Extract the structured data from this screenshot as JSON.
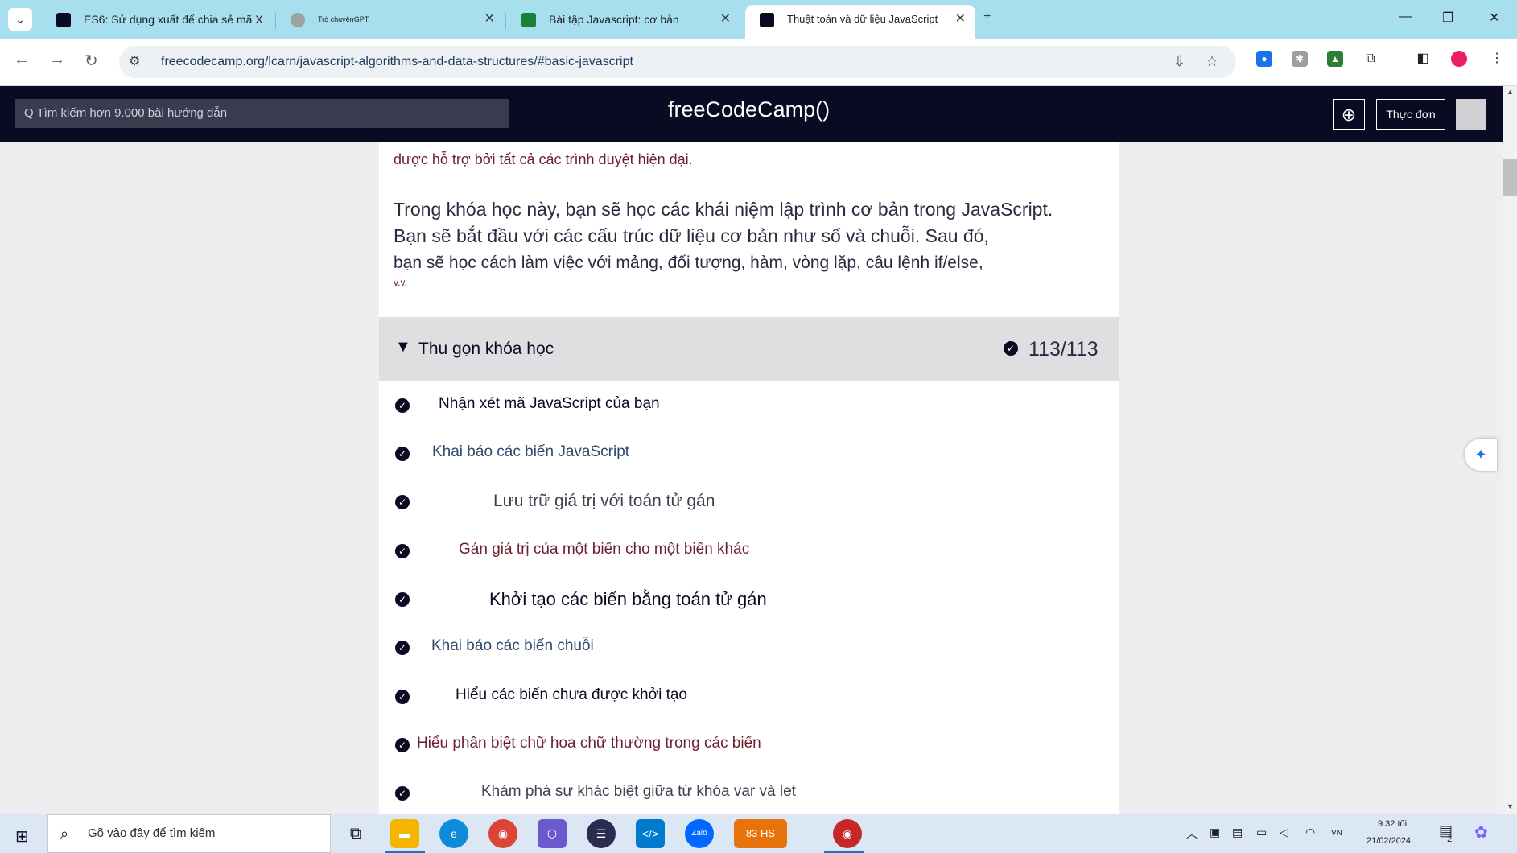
{
  "browser": {
    "tabs": [
      {
        "title": "ES6: Sử dụng xuất để chia sẻ mã X"
      },
      {
        "title": "Trò chuyệnGPT"
      },
      {
        "title": "Bài tập Javascript: cơ bản"
      },
      {
        "title": "Thuật toán và dữ liệu JavaScript"
      }
    ],
    "url": "freecodecamp.org/lcarn/javascript-algorithms-and-data-structures/#basic-javascript",
    "accent_color": "#a8dfef"
  },
  "fcc": {
    "search_placeholder": "Q Tìm kiếm hơn 9.000 bài hướng dẫn",
    "brand": "freeCodeCamp()",
    "menu_label": "Thực đơn"
  },
  "intro": {
    "line1": "được hỗ trợ bởi tất cả các trình duyệt hiện đại.",
    "para_a": "Trong khóa học này, bạn sẽ học các khái niệm lập trình cơ bản trong JavaScript.",
    "para_b": "Bạn sẽ bắt đầu với các cấu trúc dữ liệu cơ bản như số và chuỗi. Sau đó,",
    "para_c": "bạn sẽ học cách làm việc với mảng, đối tượng, hàm, vòng lặp, câu lệnh if/else,",
    "para_d": "v.v."
  },
  "course": {
    "collapse_label": "Thu gọn khóa học",
    "progress": "113/113",
    "lessons": [
      {
        "label": "Nhận xét mã JavaScript của bạn"
      },
      {
        "label": "Khai báo các biến JavaScript"
      },
      {
        "label": "Lưu trữ giá trị với toán tử gán"
      },
      {
        "label": "Gán giá trị của một biến cho một biến khác"
      },
      {
        "label": "Khởi tạo các biến bằng toán tử gán"
      },
      {
        "label": "Khai báo các biến chuỗi"
      },
      {
        "label": "Hiểu các biến chưa được khởi tạo"
      },
      {
        "label": "Hiểu phân biệt chữ hoa chữ thường trong các biến"
      },
      {
        "label": "Khám phá sự khác biệt giữa từ khóa var và let"
      }
    ]
  },
  "taskbar": {
    "search_placeholder": "Gõ vào đây để tìm kiếm",
    "badge_app": "83 HS",
    "lang": "VN",
    "time": "9:32 tối",
    "date": "21/02/2024",
    "notif_count": "2"
  }
}
